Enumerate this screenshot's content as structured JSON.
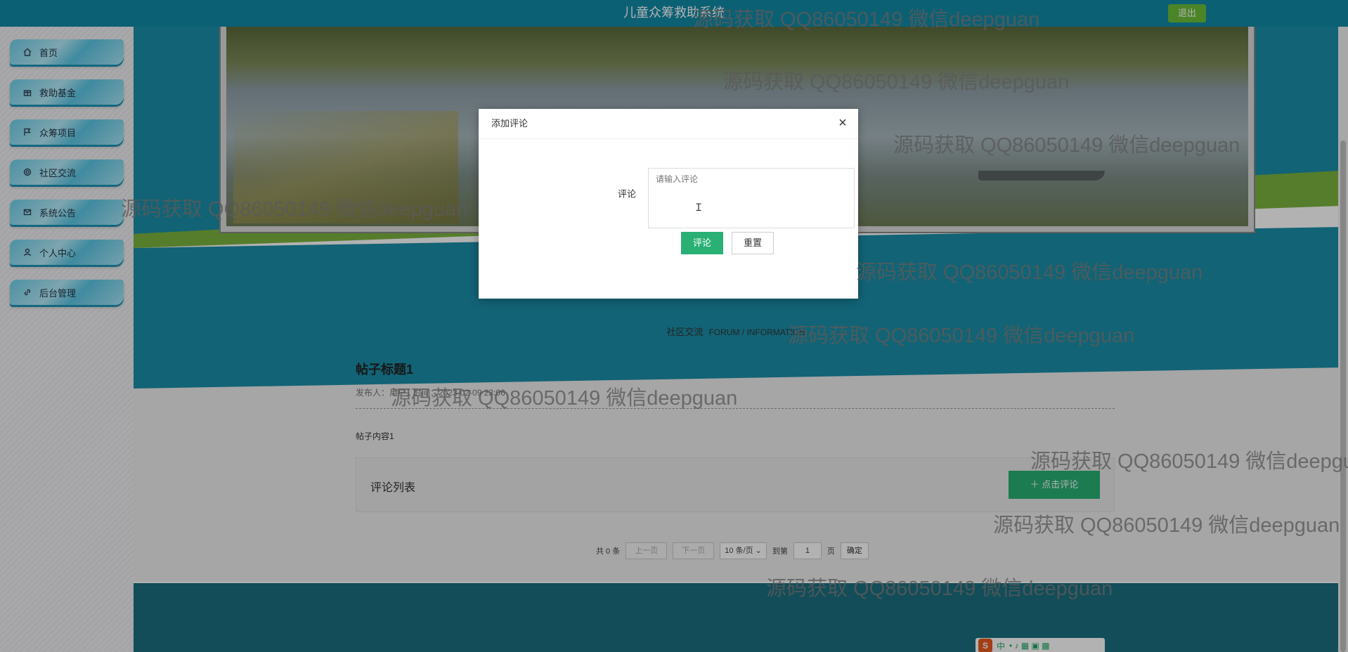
{
  "header": {
    "title": "儿童众筹救助系统",
    "logout_label": "退出"
  },
  "sidebar": {
    "items": [
      {
        "label": "首页",
        "icon": "home-icon"
      },
      {
        "label": "救助基金",
        "icon": "gift-icon"
      },
      {
        "label": "众筹项目",
        "icon": "flag-icon"
      },
      {
        "label": "社区交流",
        "icon": "chat-icon",
        "active": true
      },
      {
        "label": "系统公告",
        "icon": "mail-icon"
      },
      {
        "label": "个人中心",
        "icon": "user-icon"
      },
      {
        "label": "后台管理",
        "icon": "link-icon"
      }
    ]
  },
  "section": {
    "title": "社区交流",
    "subtitle": "FORUM / INFORMATION"
  },
  "post": {
    "title": "帖子标题1",
    "meta": "发布人：用户1  时间：2023-02-09 23:06",
    "content": "帖子内容1",
    "comments_label": "评论列表",
    "add_comment_label": "点击评论"
  },
  "pagination": {
    "total": "共 0 条",
    "prev": "上一页",
    "next": "下一页",
    "page_size": "10 条/页",
    "goto_label": "到第",
    "page_value": "1",
    "page_unit": "页",
    "confirm": "确定"
  },
  "modal": {
    "title": "添加评论",
    "close_label": "×",
    "field_label": "评论",
    "placeholder": "请输入评论",
    "submit_label": "评论",
    "reset_label": "重置"
  },
  "ime": {
    "logo": "S",
    "mode": "中"
  },
  "watermark": "源码获取 QQ86050149 微信deepguan",
  "colors": {
    "topbar": "#128aa6",
    "accent_green": "#2ab075",
    "logout": "#6cbf3a",
    "footer": "#1a6f80"
  }
}
